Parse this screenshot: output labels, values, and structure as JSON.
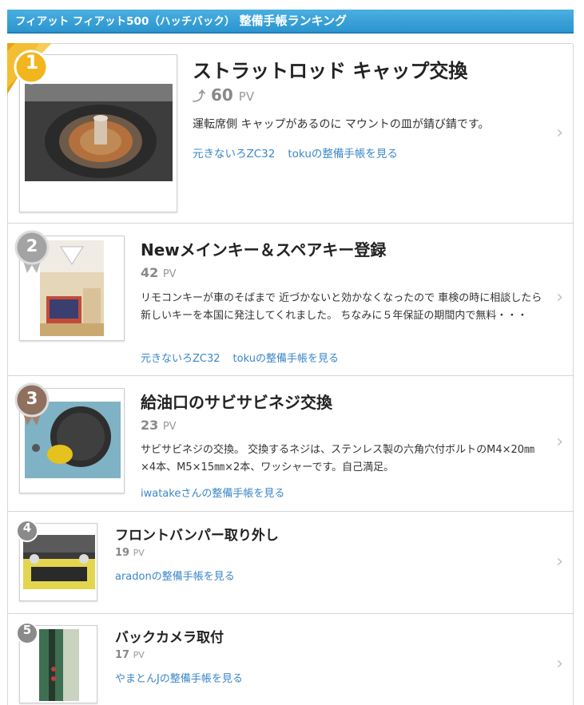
{
  "header": {
    "prefix": "フィアット フィアット500（ハッチバック）",
    "title": "整備手帳ランキング"
  },
  "colors": {
    "header_bg": "#2c95cf",
    "link": "#3b87c9",
    "gold": "#f2b51e",
    "silver": "#a3a3a3",
    "bronze": "#8f6f5e",
    "rank_gray": "#8a8a8a"
  },
  "items": [
    {
      "rank": "1",
      "title": "ストラットロッド キャップ交換",
      "pv": "60",
      "pv_unit": "PV",
      "description": "運転席側 キャップがあるのに マウントの皿が錆び錆です。",
      "links": [
        "元きないろZC32",
        "tokuの整備手帳を見る"
      ],
      "icon": "trend-icon"
    },
    {
      "rank": "2",
      "title": "Newメインキー＆スペアキー登録",
      "pv": "42",
      "pv_unit": "PV",
      "description": "リモコンキーが車のそばまで 近づかないと効かなくなったので 車検の時に相談したら 新しいキーを本国に発注してくれました。 ちなみに５年保証の期間内で無料・・・",
      "links": [
        "元きないろZC32",
        "tokuの整備手帳を見る"
      ]
    },
    {
      "rank": "3",
      "title": "給油口のサビサビネジ交換",
      "pv": "23",
      "pv_unit": "PV",
      "description": "サビサビネジの交換。 交換するネジは、ステンレス製の六角穴付ボルトのM4×20㎜×4本、M5×15㎜×2本、ワッシャーです。自己満足。",
      "links": [
        "iwatakeさんの整備手帳を見る"
      ]
    },
    {
      "rank": "4",
      "title": "フロントバンパー取り外し",
      "pv": "19",
      "pv_unit": "PV",
      "links": [
        "aradonの整備手帳を見る"
      ]
    },
    {
      "rank": "5",
      "title": "バックカメラ取付",
      "pv": "17",
      "pv_unit": "PV",
      "links": [
        "やまとんJの整備手帳を見る"
      ]
    }
  ]
}
